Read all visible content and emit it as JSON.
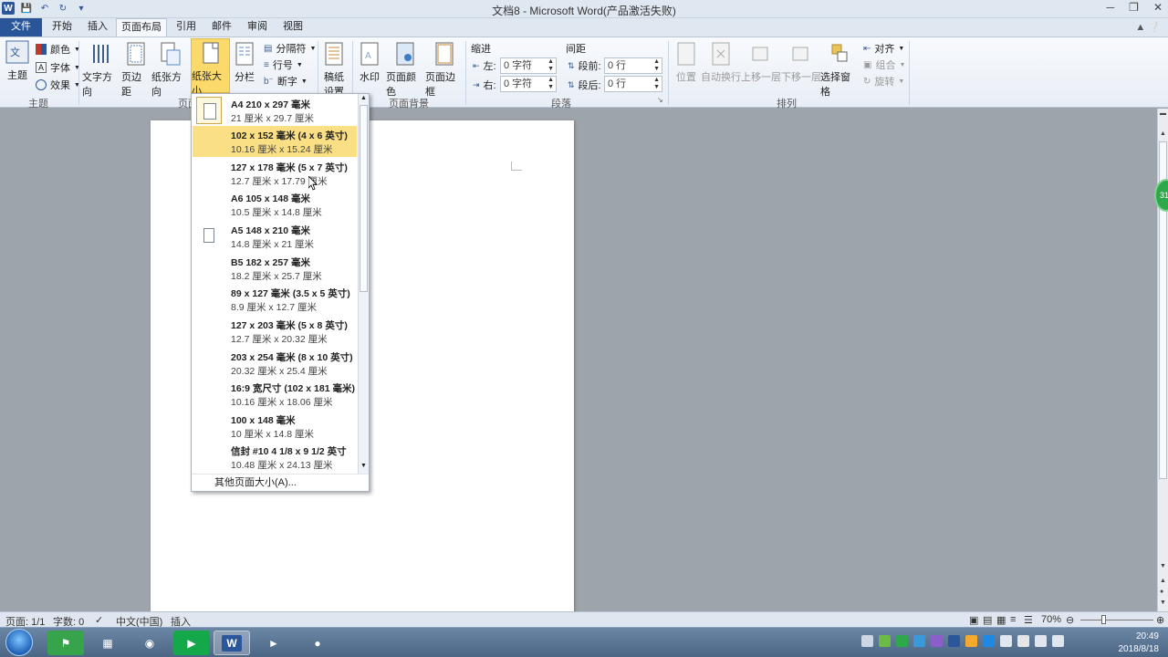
{
  "window": {
    "title": "文档8 - Microsoft Word(产品激活失败)",
    "app_icon": "W"
  },
  "tabs": [
    {
      "label": "文件"
    },
    {
      "label": "开始"
    },
    {
      "label": "插入"
    },
    {
      "label": "页面布局"
    },
    {
      "label": "引用"
    },
    {
      "label": "邮件"
    },
    {
      "label": "审阅"
    },
    {
      "label": "视图"
    }
  ],
  "ribbon": {
    "theme": {
      "big": "主题",
      "colors": "颜色",
      "fonts": "字体",
      "effects": "效果",
      "group": "主题"
    },
    "page_setup": {
      "text_direction": "文字方向",
      "margins": "页边距",
      "orientation": "纸张方向",
      "size": "纸张大小",
      "columns": "分栏",
      "breaks": "分隔符",
      "line_numbers": "行号",
      "hyphenation": "断字",
      "group": "页面"
    },
    "draft": {
      "line1": "稿纸",
      "line2": "设置"
    },
    "page_background": {
      "watermark": "水印",
      "page_color": "页面颜色",
      "page_borders": "页面边框",
      "group": "页面背景"
    },
    "paragraph": {
      "indent_label": "缩进",
      "spacing_label": "间距",
      "left": "左:",
      "left_val": "0 字符",
      "right": "右:",
      "right_val": "0 字符",
      "before": "段前:",
      "before_val": "0 行",
      "after": "段后:",
      "after_val": "0 行",
      "group": "段落"
    },
    "arrange": {
      "position": "位置",
      "wrap": "自动换行",
      "forward": "上移一层",
      "backward": "下移一层",
      "selection_pane": "选择窗格",
      "align": "对齐",
      "group_btn": "组合",
      "rotate": "旋转",
      "group": "排列"
    }
  },
  "paper_sizes": [
    {
      "name": "A4 210 x 297 毫米",
      "dims": "21 厘米 x 29.7 厘米",
      "highlight": false
    },
    {
      "name": "102 x 152 毫米 (4 x 6 英寸)",
      "dims": "10.16 厘米 x 15.24 厘米",
      "highlight": true
    },
    {
      "name": "127 x 178 毫米 (5 x 7 英寸)",
      "dims": "12.7 厘米 x 17.79 厘米",
      "highlight": false
    },
    {
      "name": "A6 105 x 148 毫米",
      "dims": "10.5 厘米 x 14.8 厘米",
      "highlight": false
    },
    {
      "name": "A5 148 x 210 毫米",
      "dims": "14.8 厘米 x 21 厘米",
      "highlight": false
    },
    {
      "name": "B5 182 x 257 毫米",
      "dims": "18.2 厘米 x 25.7 厘米",
      "highlight": false
    },
    {
      "name": "89 x 127 毫米 (3.5 x 5 英寸)",
      "dims": "8.9 厘米 x 12.7 厘米",
      "highlight": false
    },
    {
      "name": "127 x 203 毫米 (5 x 8 英寸)",
      "dims": "12.7 厘米 x 20.32 厘米",
      "highlight": false
    },
    {
      "name": "203 x 254 毫米 (8 x 10 英寸)",
      "dims": "20.32 厘米 x 25.4 厘米",
      "highlight": false
    },
    {
      "name": "16:9 宽尺寸 (102 x 181 毫米)",
      "dims": "10.16 厘米 x 18.06 厘米",
      "highlight": false
    },
    {
      "name": "100 x 148 毫米",
      "dims": "10 厘米 x 14.8 厘米",
      "highlight": false
    },
    {
      "name": "信封 #10 4 1/8 x 9 1/2 英寸",
      "dims": "10.48 厘米 x 24.13 厘米",
      "highlight": false
    }
  ],
  "more_sizes": "其他页面大小(A)...",
  "side_badge": "31",
  "status": {
    "page": "页面: 1/1",
    "words": "字数: 0",
    "language": "中文(中国)",
    "mode": "插入",
    "zoom": "70%"
  },
  "taskbar": {
    "time": "20:49",
    "date": "2018/8/18"
  },
  "colors": {
    "accent": "#2b579a",
    "highlight": "#fbdf84",
    "selected_button": "#fbd96a"
  }
}
